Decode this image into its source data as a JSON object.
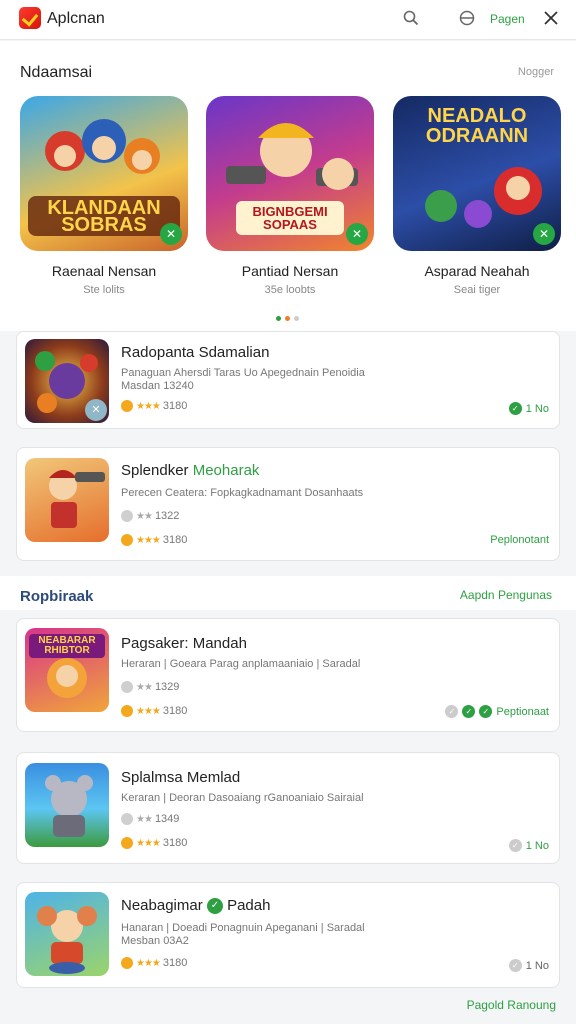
{
  "header": {
    "app_title": "Aplcnan",
    "top_link": "Pagen"
  },
  "featured": {
    "title": "Ndaamsai",
    "link": "Nogger",
    "items": [
      {
        "name": "Raenaal Nensan",
        "sub": "Ste lolits",
        "art": "KLANDAAN\nSOBRAS"
      },
      {
        "name": "Pantiad Nersan",
        "sub": "35e loobts",
        "art": "BIGNBGEMI\nSOPAAS"
      },
      {
        "name": "Asparad Neahah",
        "sub": "Seai tiger",
        "art": "NEADALO\nODRAANN"
      }
    ],
    "dots": [
      "#2ea043",
      "#f07d2a",
      "#cccccc"
    ]
  },
  "list1": [
    {
      "title": "Radopanta Sdamalian",
      "title_hl": "",
      "desc": "Panaguan Ahersdi Taras Uo Apegednain Penoidia",
      "desc2": "Masdan 13240",
      "rating": "3180",
      "action": "1 No"
    },
    {
      "title": "Splendker",
      "title_hl": "Meoharak",
      "desc": "Perecen Ceatera: Fopkagkadnamant Dosanhaats",
      "sub_rating": "1322",
      "rating": "3180",
      "action": "Peplonotant"
    }
  ],
  "section2": {
    "title": "Ropbiraak",
    "link": "Aapdn Pengunas"
  },
  "list2": [
    {
      "title": "Pagsaker: Mandah",
      "desc": "Heraran | Goeara Parag anplamaaniaio | Saradal",
      "sub_rating": "1329",
      "rating": "3180",
      "action": "Peptionaat",
      "art": "NEABARAR\nRHIBTOR"
    },
    {
      "title": "Splalmsa Memlad",
      "desc": "Keraran | Deoran Dasoaiang rGanoaniaio Sairaial",
      "sub_rating": "1349",
      "rating": "3180",
      "action": "1 No"
    },
    {
      "title": "Neabagimar",
      "title_after": "Padah",
      "desc": "Hanaran | Doeadi Ponagnuin Apeganani | Saradal",
      "desc2": "Mesban 03A2",
      "rating": "3180",
      "action": "1 No"
    }
  ],
  "footer": {
    "link": "Pagold Ranoung"
  }
}
